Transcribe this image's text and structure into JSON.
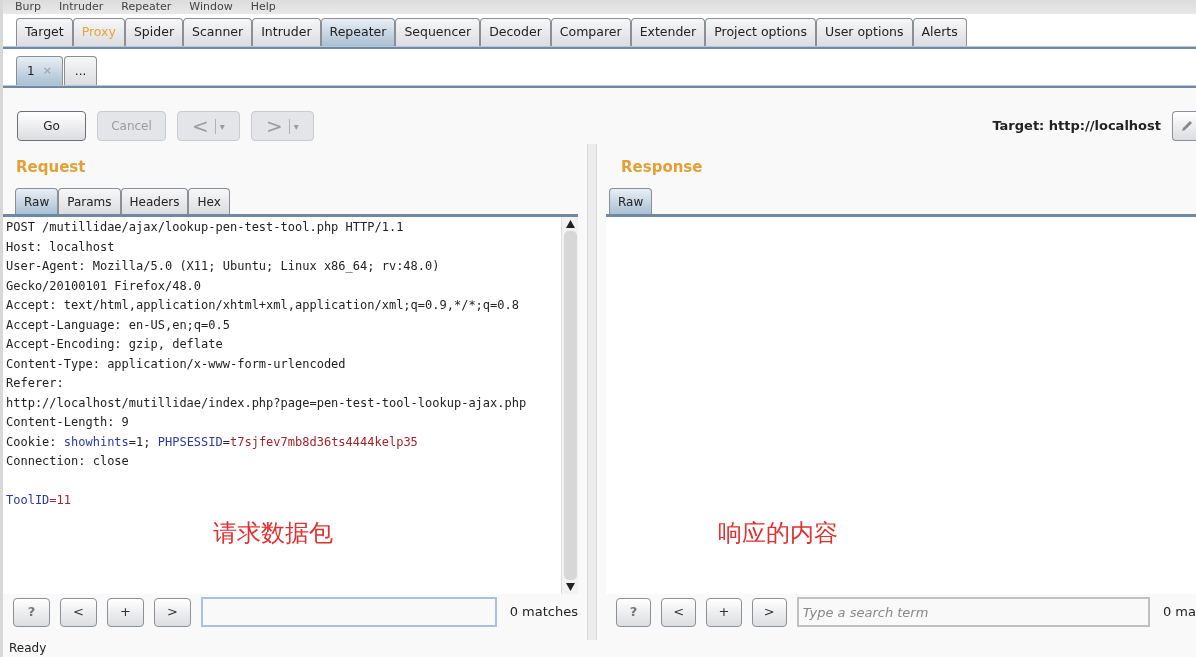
{
  "menu_bar": [
    "Burp",
    "Intruder",
    "Repeater",
    "Window",
    "Help"
  ],
  "main_tabs": [
    {
      "label": "Target",
      "selected": false,
      "highlighted": false
    },
    {
      "label": "Proxy",
      "selected": false,
      "highlighted": true
    },
    {
      "label": "Spider",
      "selected": false,
      "highlighted": false
    },
    {
      "label": "Scanner",
      "selected": false,
      "highlighted": false
    },
    {
      "label": "Intruder",
      "selected": false,
      "highlighted": false
    },
    {
      "label": "Repeater",
      "selected": true,
      "highlighted": false
    },
    {
      "label": "Sequencer",
      "selected": false,
      "highlighted": false
    },
    {
      "label": "Decoder",
      "selected": false,
      "highlighted": false
    },
    {
      "label": "Comparer",
      "selected": false,
      "highlighted": false
    },
    {
      "label": "Extender",
      "selected": false,
      "highlighted": false
    },
    {
      "label": "Project options",
      "selected": false,
      "highlighted": false
    },
    {
      "label": "User options",
      "selected": false,
      "highlighted": false
    },
    {
      "label": "Alerts",
      "selected": false,
      "highlighted": false
    }
  ],
  "repeater_tabs": [
    {
      "label": "1",
      "close": "×",
      "selected": true
    },
    {
      "label": "...",
      "selected": false
    }
  ],
  "toolbar": {
    "buttons": [
      {
        "kind": "text",
        "label": "Go",
        "disabled": false
      },
      {
        "kind": "text",
        "label": "Cancel",
        "disabled": true
      },
      {
        "kind": "history",
        "label": "<",
        "caret": "▾",
        "disabled": true
      },
      {
        "kind": "history",
        "label": ">",
        "caret": "▾",
        "disabled": true
      }
    ],
    "target": "Target: http://localhost"
  },
  "request": {
    "title": "Request",
    "tabs": [
      {
        "label": "Raw",
        "selected": true
      },
      {
        "label": "Params",
        "selected": false
      },
      {
        "label": "Headers",
        "selected": false
      },
      {
        "label": "Hex",
        "selected": false
      }
    ],
    "headers": [
      [
        {
          "kind": "plain",
          "text": "POST /mutillidae/ajax/lookup-pen-test-tool.php HTTP/1.1"
        }
      ],
      [
        {
          "kind": "plain",
          "text": "Host: localhost"
        }
      ],
      [
        {
          "kind": "plain",
          "text": "User-Agent: Mozilla/5.0 (X11; Ubuntu; Linux x86_64; rv:48.0)"
        }
      ],
      [
        {
          "kind": "plain",
          "text": "Gecko/20100101 Firefox/48.0"
        }
      ],
      [
        {
          "kind": "plain",
          "text": "Accept: text/html,application/xhtml+xml,application/xml;q=0.9,*/*;q=0.8"
        }
      ],
      [
        {
          "kind": "plain",
          "text": "Accept-Language: en-US,en;q=0.5"
        }
      ],
      [
        {
          "kind": "plain",
          "text": "Accept-Encoding: gzip, deflate"
        }
      ],
      [
        {
          "kind": "plain",
          "text": "Content-Type: application/x-www-form-urlencoded"
        }
      ],
      [
        {
          "kind": "plain",
          "text": "Referer:"
        }
      ],
      [
        {
          "kind": "plain",
          "text": "http://localhost/mutillidae/index.php?page=pen-test-tool-lookup-ajax.php"
        }
      ],
      [
        {
          "kind": "plain",
          "text": "Content-Length: 9"
        }
      ],
      [
        {
          "kind": "plain",
          "text": "Cookie: "
        },
        {
          "kind": "name",
          "text": "showhints"
        },
        {
          "kind": "plain",
          "text": "=1; "
        },
        {
          "kind": "name",
          "text": "PHPSESSID"
        },
        {
          "kind": "plain",
          "text": "="
        },
        {
          "kind": "value",
          "text": "t7sjfev7mb8d36ts4444kelp35"
        }
      ],
      [
        {
          "kind": "plain",
          "text": "Connection: close"
        }
      ]
    ],
    "body": [
      [
        {
          "kind": "name",
          "text": "ToolID"
        },
        {
          "kind": "value",
          "text": "=11"
        }
      ]
    ],
    "annotation": "请求数据包",
    "search": {
      "buttons": [
        "?",
        "<",
        "+",
        ">"
      ],
      "matches": "0 matches"
    }
  },
  "response": {
    "title": "Response",
    "tabs": [
      {
        "label": "Raw",
        "selected": true
      }
    ],
    "annotation": "响应的内容",
    "search": {
      "buttons": [
        "?",
        "<",
        "+",
        ">"
      ],
      "placeholder": "Type a search term",
      "matches": "0 ma"
    }
  },
  "status_bar": "Ready"
}
